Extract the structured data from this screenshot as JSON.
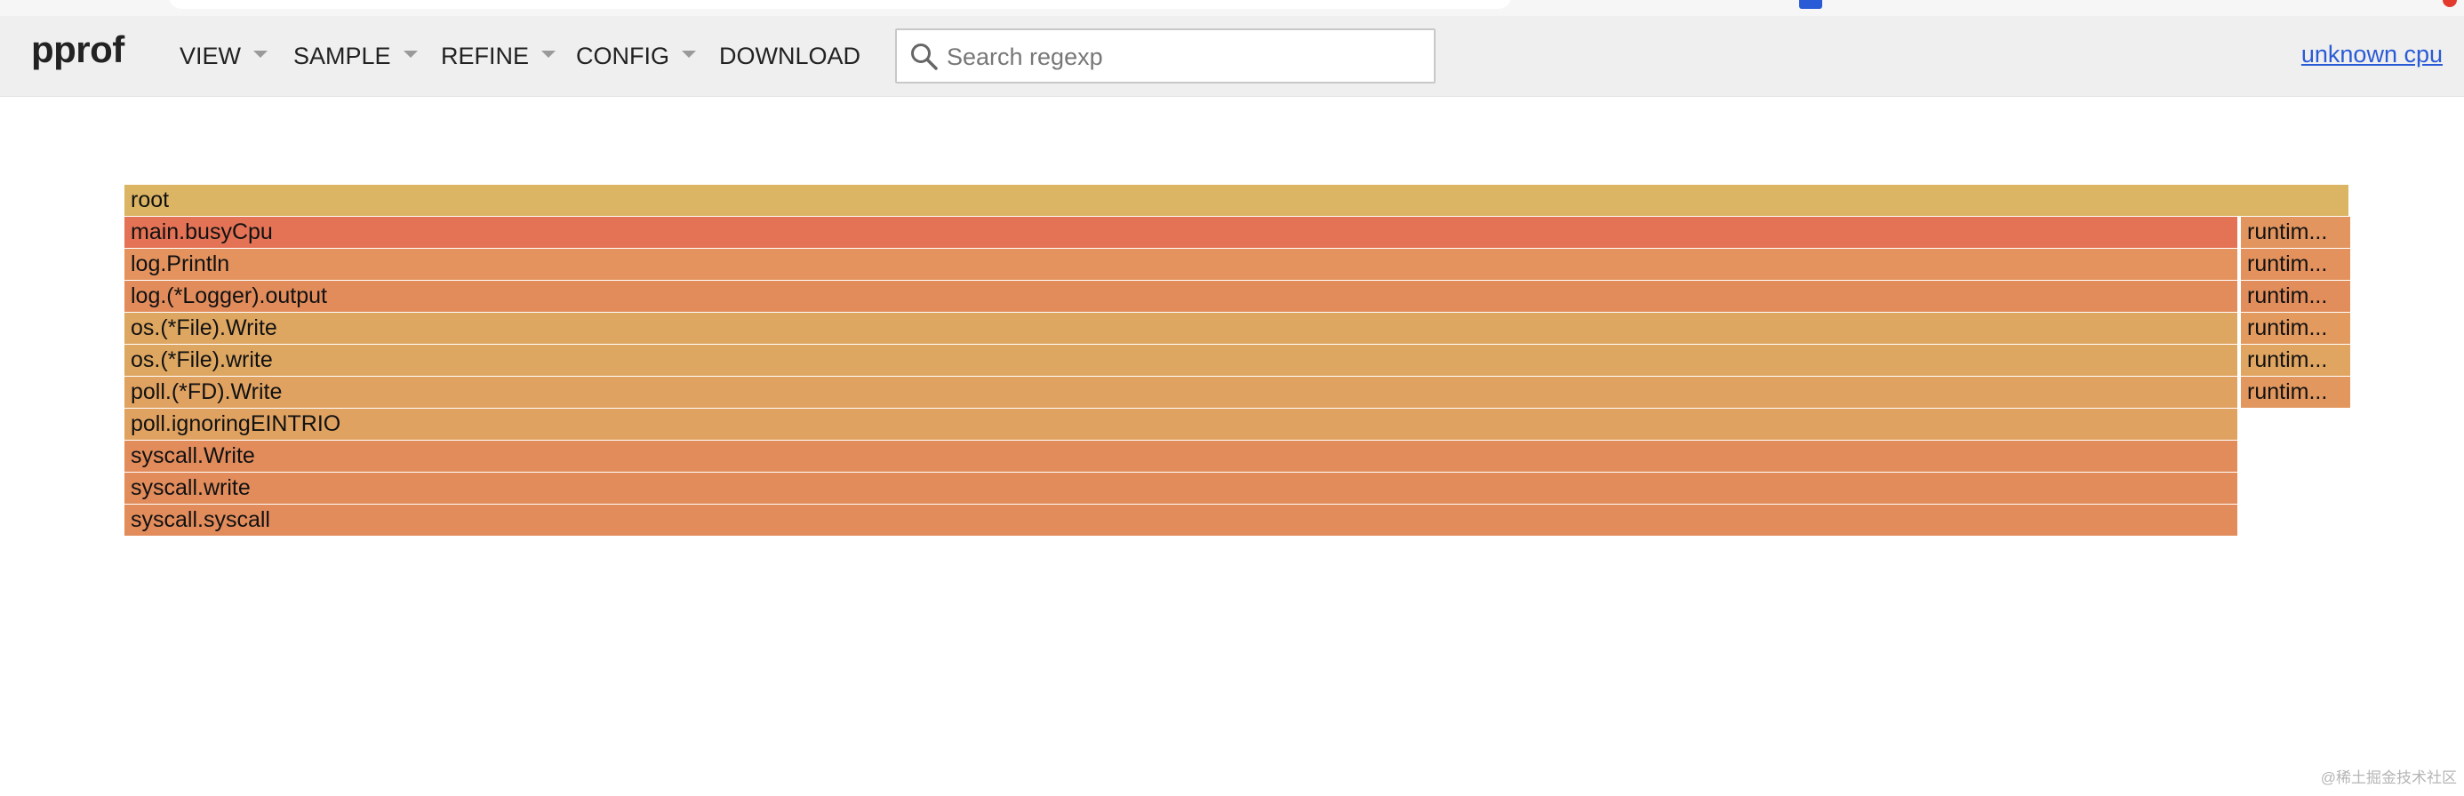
{
  "header": {
    "logo": "pprof",
    "menu": [
      {
        "label": "VIEW",
        "dropdown": true
      },
      {
        "label": "SAMPLE",
        "dropdown": true
      },
      {
        "label": "REFINE",
        "dropdown": true
      },
      {
        "label": "CONFIG",
        "dropdown": true
      },
      {
        "label": "DOWNLOAD",
        "dropdown": false
      }
    ],
    "search": {
      "placeholder": "Search regexp",
      "value": ""
    },
    "cpu_link": "unknown cpu"
  },
  "flamegraph": {
    "frames": [
      {
        "label": "root",
        "depth": 0,
        "start": 0,
        "share": 1.0,
        "color": "#dbb564"
      },
      {
        "label": "main.busyCpu",
        "depth": 1,
        "start": 0,
        "share": 0.95,
        "color": "#e47356"
      },
      {
        "label": "runtim...",
        "depth": 1,
        "start": 0.95,
        "share": 0.05,
        "color": "#e2955e"
      },
      {
        "label": "log.Println",
        "depth": 2,
        "start": 0,
        "share": 0.95,
        "color": "#e4935e"
      },
      {
        "label": "runtim...",
        "depth": 2,
        "start": 0.95,
        "share": 0.05,
        "color": "#e4925d"
      },
      {
        "label": "log.(*Logger).output",
        "depth": 3,
        "start": 0,
        "share": 0.95,
        "color": "#e28c5c"
      },
      {
        "label": "runtim...",
        "depth": 3,
        "start": 0.95,
        "share": 0.05,
        "color": "#e28e5c"
      },
      {
        "label": "os.(*File).Write",
        "depth": 4,
        "start": 0,
        "share": 0.95,
        "color": "#dea761"
      },
      {
        "label": "runtim...",
        "depth": 4,
        "start": 0.95,
        "share": 0.05,
        "color": "#e29a5e"
      },
      {
        "label": "os.(*File).write",
        "depth": 5,
        "start": 0,
        "share": 0.95,
        "color": "#dea761"
      },
      {
        "label": "runtim...",
        "depth": 5,
        "start": 0.95,
        "share": 0.05,
        "color": "#e0a560"
      },
      {
        "label": "poll.(*FD).Write",
        "depth": 6,
        "start": 0,
        "share": 0.95,
        "color": "#e0a261"
      },
      {
        "label": "runtim...",
        "depth": 6,
        "start": 0.95,
        "share": 0.05,
        "color": "#e2975e"
      },
      {
        "label": "poll.ignoringEINTRIO",
        "depth": 7,
        "start": 0,
        "share": 0.95,
        "color": "#e0a261"
      },
      {
        "label": "syscall.Write",
        "depth": 8,
        "start": 0,
        "share": 0.95,
        "color": "#e28c5c"
      },
      {
        "label": "syscall.write",
        "depth": 9,
        "start": 0,
        "share": 0.95,
        "color": "#e28c5c"
      },
      {
        "label": "syscall.syscall",
        "depth": 10,
        "start": 0,
        "share": 0.95,
        "color": "#e28c5c"
      }
    ]
  },
  "watermark": "@稀土掘金技术社区"
}
